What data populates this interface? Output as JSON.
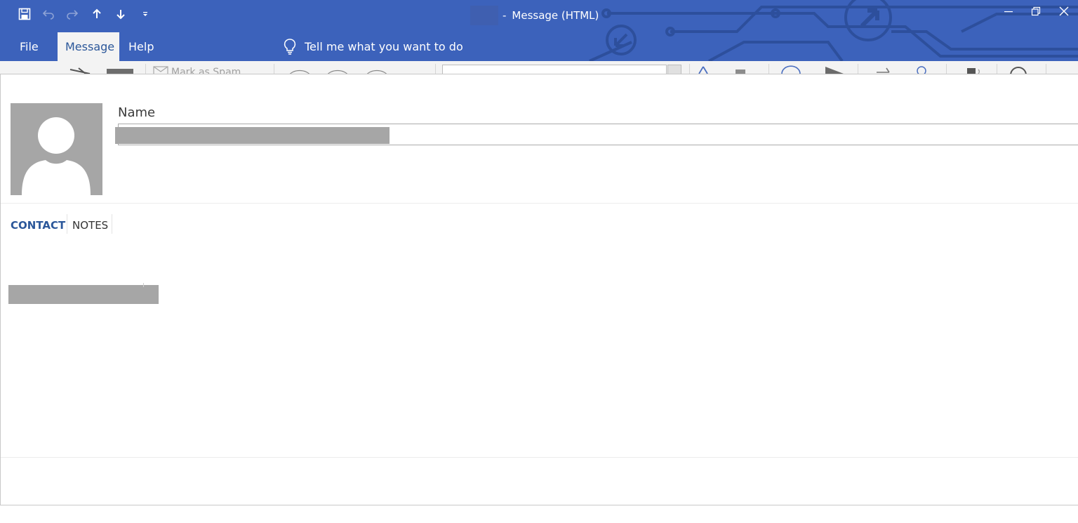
{
  "window": {
    "title": "Message (HTML)",
    "title_separator": "-"
  },
  "colors": {
    "titlebar": "#3c62bb",
    "active_tab_text": "#2b579a",
    "redaction": "#a6a6a6"
  },
  "quick_access": [
    {
      "icon": "save-icon"
    },
    {
      "icon": "undo-icon"
    },
    {
      "icon": "redo-icon"
    },
    {
      "icon": "previous-item-icon"
    },
    {
      "icon": "next-item-icon"
    },
    {
      "icon": "customize-toolbar-icon"
    }
  ],
  "window_controls": [
    "minimize-icon",
    "restore-icon",
    "close-icon"
  ],
  "tabs": [
    {
      "label": "File",
      "active": false
    },
    {
      "label": "Message",
      "active": true
    },
    {
      "label": "Help",
      "active": false
    }
  ],
  "tell_me": {
    "icon": "lightbulb-icon",
    "label": "Tell me what you want to do"
  },
  "ribbon": {
    "mark_as_spam": "Mark as Spam"
  },
  "contact": {
    "name_label": "Name",
    "tabs": [
      {
        "label": "CONTACT",
        "active": true
      },
      {
        "label": "NOTES",
        "active": false
      }
    ]
  }
}
